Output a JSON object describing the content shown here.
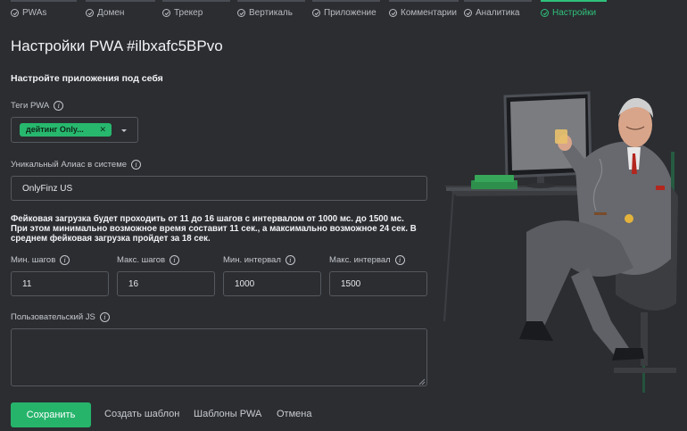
{
  "steps": [
    {
      "label": "PWAs",
      "active": false
    },
    {
      "label": "Домен",
      "active": false
    },
    {
      "label": "Трекер",
      "active": false
    },
    {
      "label": "Вертикаль",
      "active": false
    },
    {
      "label": "Приложение",
      "active": false
    },
    {
      "label": "Комментарии",
      "active": false
    },
    {
      "label": "Аналитика",
      "active": false
    },
    {
      "label": "Настройки",
      "active": true
    }
  ],
  "page": {
    "title": "Настройки PWA #ilbxafc5BPvo",
    "subtitle": "Настройте приложения под себя"
  },
  "tags": {
    "label": "Теги PWA",
    "selected": [
      "дейтинг Only..."
    ]
  },
  "alias": {
    "label": "Уникальный Алиас в системе",
    "value": "OnlyFinz US"
  },
  "fake_loading": {
    "p1": "Фейковая загрузка будет проходить от ",
    "min_steps": "11",
    "p2": " до ",
    "max_steps": "16",
    "p3": " шагов с интервалом от ",
    "min_interval": "1000 мс.",
    "p4": " до ",
    "max_interval": "1500 мс.",
    "p5": " При этом минимально возможное время составит ",
    "min_time": "11 сек.",
    "p6": ", а максимально возможное ",
    "max_time": "24 сек.",
    "p7": " В среднем фейковая загрузка пройдет за ",
    "avg_time": "18 сек."
  },
  "fields": {
    "min_steps": {
      "label": "Мин. шагов",
      "value": "11"
    },
    "max_steps": {
      "label": "Макс. шагов",
      "value": "16"
    },
    "min_interval": {
      "label": "Мин. интервал",
      "value": "1000"
    },
    "max_interval": {
      "label": "Макс. интервал",
      "value": "1500"
    }
  },
  "custom_js": {
    "label": "Пользовательский JS",
    "value": ""
  },
  "actions": {
    "save": "Сохранить",
    "create_template": "Создать шаблон",
    "templates": "Шаблоны PWA",
    "cancel": "Отмена"
  },
  "colors": {
    "accent": "#26b46b",
    "background": "#2b2d31",
    "border": "#55585e"
  }
}
